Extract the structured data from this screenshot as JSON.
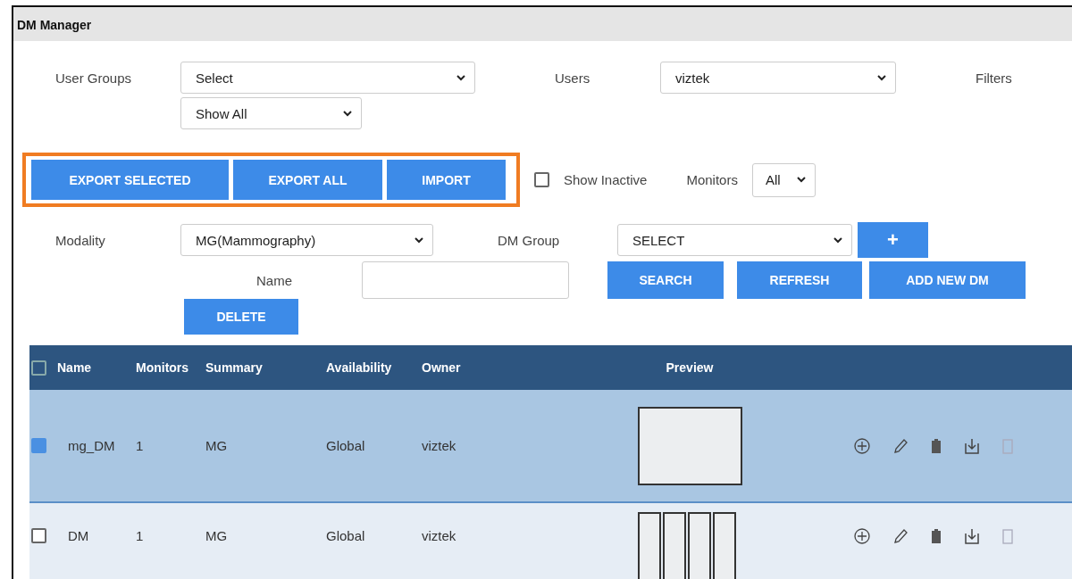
{
  "window": {
    "title": "DM Manager"
  },
  "filters": {
    "user_groups": {
      "label": "User Groups",
      "value": "Select"
    },
    "users": {
      "label": "Users",
      "value": "viztek"
    },
    "filters_label": "Filters",
    "show": {
      "value": "Show All"
    }
  },
  "export_buttons": [
    "EXPORT SELECTED",
    "EXPORT ALL",
    "IMPORT"
  ],
  "show_inactive": {
    "label": "Show Inactive",
    "checked": false
  },
  "monitors": {
    "label": "Monitors",
    "value": "All"
  },
  "modality": {
    "label": "Modality",
    "value": "MG(Mammography)"
  },
  "dm_group": {
    "label": "DM Group",
    "value": "SELECT",
    "add_button": "+"
  },
  "name_field": {
    "label": "Name"
  },
  "action_buttons": [
    "SEARCH",
    "REFRESH",
    "ADD NEW DM"
  ],
  "delete_button": "DELETE",
  "table": {
    "select_all": false,
    "columns": [
      "Name",
      "Monitors",
      "Summary",
      "Availability",
      "Owner",
      "Preview"
    ],
    "rows": [
      {
        "selected": true,
        "cells": [
          "mg_DM",
          "1",
          "MG",
          "Global",
          "viztek"
        ],
        "preview": {
          "kind": "single"
        }
      },
      {
        "selected": false,
        "cells": [
          "DM",
          "1",
          "MG",
          "Global",
          "viztek"
        ],
        "preview": {
          "kind": "quad"
        }
      }
    ]
  }
}
